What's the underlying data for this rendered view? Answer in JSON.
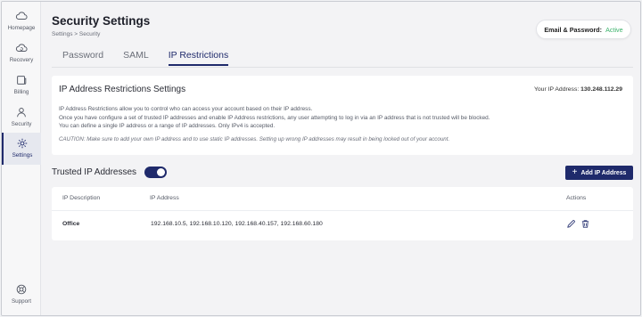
{
  "sidebar": {
    "items": [
      {
        "label": "Homepage",
        "icon": "cloud-icon"
      },
      {
        "label": "Recovery",
        "icon": "cloud-refresh-icon"
      },
      {
        "label": "Billing",
        "icon": "billing-icon"
      },
      {
        "label": "Security",
        "icon": "user-icon"
      },
      {
        "label": "Settings",
        "icon": "gear-icon"
      }
    ],
    "support_label": "Support"
  },
  "header": {
    "title": "Security Settings",
    "breadcrumb": "Settings > Security",
    "status_label": "Email & Password:",
    "status_value": "Active"
  },
  "tabs": [
    {
      "label": "Password"
    },
    {
      "label": "SAML"
    },
    {
      "label": "IP Restrictions"
    }
  ],
  "restrictions": {
    "title": "IP Address Restrictions Settings",
    "your_ip_label": "Your IP Address:",
    "your_ip_value": "130.248.112.29",
    "lines": [
      "IP Address Restrictions allow you to control who can access your account based on their IP address.",
      "Once you have configure a set of trusted IP addresses and enable IP Address restrictions, any user attempting to log in via an IP address that is not trusted will be blocked.",
      "You can define a single IP address or a range of IP addresses. Only IPv4 is accepted."
    ],
    "caution": "CAUTION: Make sure to add your own IP address and to use static IP addresses. Setting up wrong IP addresses may result in being locked out of your account."
  },
  "trusted": {
    "label": "Trusted IP Addresses",
    "enabled": true,
    "add_button": "Add IP Address"
  },
  "table": {
    "headers": [
      "IP Description",
      "IP Address",
      "Actions"
    ],
    "rows": [
      {
        "description": "Office",
        "addresses": "192.168.10.5, 192.168.10.120, 192.168.40.157, 192.168.60.180"
      }
    ]
  },
  "colors": {
    "accent": "#1f2a6b",
    "active_status": "#3bb26b"
  }
}
